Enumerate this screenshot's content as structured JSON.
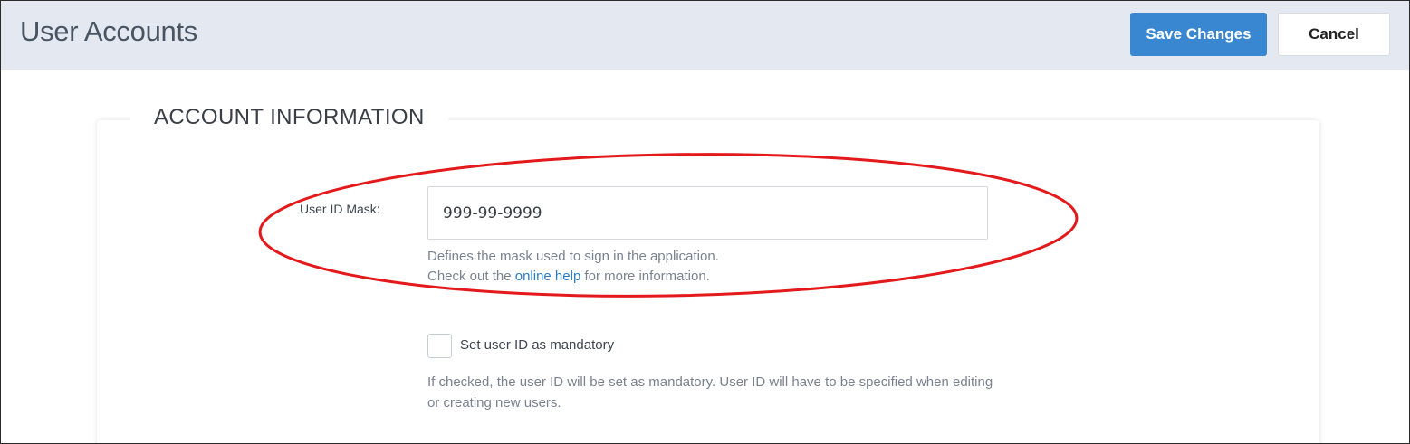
{
  "header": {
    "title": "User Accounts",
    "save_label": "Save Changes",
    "cancel_label": "Cancel"
  },
  "section": {
    "title": "ACCOUNT INFORMATION"
  },
  "user_id_mask": {
    "label": "User ID Mask:",
    "value": "999-99-9999",
    "help_line1": "Defines the mask used to sign in the application.",
    "help_prefix": "Check out the ",
    "help_link": "online help",
    "help_suffix": " for more information."
  },
  "mandatory": {
    "label": "Set user ID as mandatory",
    "checked": false,
    "description": "If checked, the user ID will be set as mandatory. User ID will have to be specified when editing or creating new users."
  },
  "colors": {
    "header_bg": "#e4e9f1",
    "primary": "#3a87d1",
    "link": "#2b7bc6",
    "annotation": "#e3191c"
  },
  "icons": {
    "annotation": "red-ellipse-highlight"
  }
}
